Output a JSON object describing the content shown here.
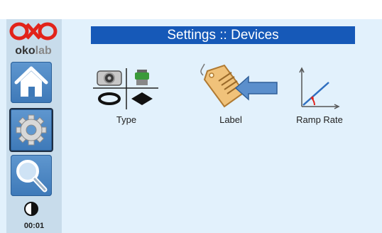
{
  "app": {
    "brand_mark": "okolab",
    "brand_mark_dark": "oko",
    "brand_mark_light": "lab"
  },
  "header": {
    "title": "Settings :: Devices"
  },
  "sidebar": {
    "items": [
      {
        "icon": "home-icon",
        "active": false
      },
      {
        "icon": "gear-icon",
        "active": true
      },
      {
        "icon": "search-icon",
        "active": false
      }
    ],
    "timer": "00:01"
  },
  "main": {
    "tiles": [
      {
        "label": "Type",
        "icon": "device-type-icon"
      },
      {
        "label": "Label",
        "icon": "label-tag-icon"
      },
      {
        "label": "Ramp Rate",
        "icon": "ramp-rate-icon"
      }
    ]
  },
  "colors": {
    "panel_bg": "#e2f1fc",
    "sidebar_bg": "#c8dceb",
    "title_bar": "#1659b8",
    "button": "#4a86c3",
    "logo_red": "#e2231a"
  }
}
